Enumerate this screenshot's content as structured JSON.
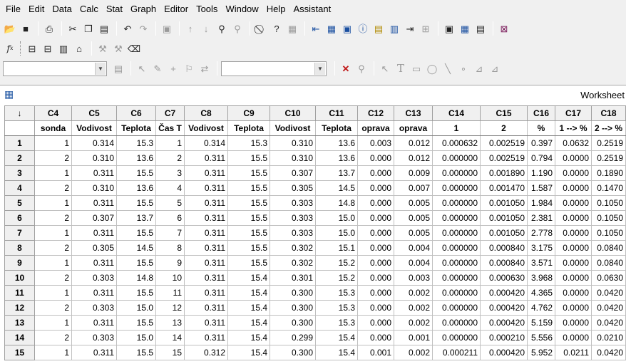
{
  "menu": [
    "File",
    "Edit",
    "Data",
    "Calc",
    "Stat",
    "Graph",
    "Editor",
    "Tools",
    "Window",
    "Help",
    "Assistant"
  ],
  "toolbar_icons": {
    "row1": [
      "open-icon",
      "save-icon",
      "|",
      "print-icon",
      "|",
      "cut-icon",
      "copy-icon",
      "paste-icon",
      "|",
      "undo-icon",
      "redo-icon",
      "|",
      "edit-last-dialog-icon",
      "|",
      "up-arrow-icon",
      "down-arrow-icon",
      "find-icon",
      "find-next-icon",
      "|",
      "cancel-icon",
      "help-icon",
      "assistant-icon",
      "|",
      "session-window-icon",
      "worksheet-icon",
      "project-manager-icon",
      "info-icon",
      "history-icon",
      "graphs-icon",
      "reports-icon",
      "related-documents-icon",
      "|",
      "tile-icon",
      "show-worksheet-icon",
      "show-info-icon",
      "|",
      "close-all-graphs-icon"
    ],
    "row2": [
      "formula-icon",
      "|",
      "brush-icon",
      "select-data-icon",
      "graph-data-icon",
      "update-icon",
      "|",
      "brush-disabled-icon",
      "brush2-disabled-icon",
      "eraser-icon"
    ],
    "row3": [
      "select-icon",
      "edit-icon",
      "crosshair-icon",
      "flag-icon",
      "swap-icon",
      "|",
      "delete-icon",
      "zoom-icon",
      "|",
      "pointer-icon",
      "text-icon",
      "rectangle-icon",
      "ellipse-icon",
      "line-icon",
      "dot-icon",
      "polyline-icon",
      "polygon-icon"
    ]
  },
  "combos": {
    "combo1": "",
    "combo2": ""
  },
  "worksheet": {
    "title": "Worksheet",
    "corner_symbol": "↓",
    "columns": [
      "C4",
      "C5",
      "C6",
      "C7",
      "C8",
      "C9",
      "C10",
      "C11",
      "C12",
      "C13",
      "C14",
      "C15",
      "C16",
      "C17",
      "C18"
    ],
    "column_names": [
      "sonda",
      "Vodivost",
      "Teplota",
      "Čas T",
      "Vodivost",
      "Teplota",
      "Vodivost",
      "Teplota",
      "oprava",
      "oprava",
      "1",
      "2",
      "%",
      "1 --> %",
      "2 --> %"
    ],
    "rows": [
      {
        "n": "1",
        "v": [
          "1",
          "0.314",
          "15.3",
          "1",
          "0.314",
          "15.3",
          "0.310",
          "13.6",
          "0.003",
          "0.012",
          "0.000632",
          "0.002519",
          "0.397",
          "0.0632",
          "0.2519"
        ]
      },
      {
        "n": "2",
        "v": [
          "2",
          "0.310",
          "13.6",
          "2",
          "0.311",
          "15.5",
          "0.310",
          "13.6",
          "0.000",
          "0.012",
          "0.000000",
          "0.002519",
          "0.794",
          "0.0000",
          "0.2519"
        ]
      },
      {
        "n": "3",
        "v": [
          "1",
          "0.311",
          "15.5",
          "3",
          "0.311",
          "15.5",
          "0.307",
          "13.7",
          "0.000",
          "0.009",
          "0.000000",
          "0.001890",
          "1.190",
          "0.0000",
          "0.1890"
        ]
      },
      {
        "n": "4",
        "v": [
          "2",
          "0.310",
          "13.6",
          "4",
          "0.311",
          "15.5",
          "0.305",
          "14.5",
          "0.000",
          "0.007",
          "0.000000",
          "0.001470",
          "1.587",
          "0.0000",
          "0.1470"
        ]
      },
      {
        "n": "5",
        "v": [
          "1",
          "0.311",
          "15.5",
          "5",
          "0.311",
          "15.5",
          "0.303",
          "14.8",
          "0.000",
          "0.005",
          "0.000000",
          "0.001050",
          "1.984",
          "0.0000",
          "0.1050"
        ]
      },
      {
        "n": "6",
        "v": [
          "2",
          "0.307",
          "13.7",
          "6",
          "0.311",
          "15.5",
          "0.303",
          "15.0",
          "0.000",
          "0.005",
          "0.000000",
          "0.001050",
          "2.381",
          "0.0000",
          "0.1050"
        ]
      },
      {
        "n": "7",
        "v": [
          "1",
          "0.311",
          "15.5",
          "7",
          "0.311",
          "15.5",
          "0.303",
          "15.0",
          "0.000",
          "0.005",
          "0.000000",
          "0.001050",
          "2.778",
          "0.0000",
          "0.1050"
        ]
      },
      {
        "n": "8",
        "v": [
          "2",
          "0.305",
          "14.5",
          "8",
          "0.311",
          "15.5",
          "0.302",
          "15.1",
          "0.000",
          "0.004",
          "0.000000",
          "0.000840",
          "3.175",
          "0.0000",
          "0.0840"
        ]
      },
      {
        "n": "9",
        "v": [
          "1",
          "0.311",
          "15.5",
          "9",
          "0.311",
          "15.5",
          "0.302",
          "15.2",
          "0.000",
          "0.004",
          "0.000000",
          "0.000840",
          "3.571",
          "0.0000",
          "0.0840"
        ]
      },
      {
        "n": "10",
        "v": [
          "2",
          "0.303",
          "14.8",
          "10",
          "0.311",
          "15.4",
          "0.301",
          "15.2",
          "0.000",
          "0.003",
          "0.000000",
          "0.000630",
          "3.968",
          "0.0000",
          "0.0630"
        ]
      },
      {
        "n": "11",
        "v": [
          "1",
          "0.311",
          "15.5",
          "11",
          "0.311",
          "15.4",
          "0.300",
          "15.3",
          "0.000",
          "0.002",
          "0.000000",
          "0.000420",
          "4.365",
          "0.0000",
          "0.0420"
        ]
      },
      {
        "n": "12",
        "v": [
          "2",
          "0.303",
          "15.0",
          "12",
          "0.311",
          "15.4",
          "0.300",
          "15.3",
          "0.000",
          "0.002",
          "0.000000",
          "0.000420",
          "4.762",
          "0.0000",
          "0.0420"
        ]
      },
      {
        "n": "13",
        "v": [
          "1",
          "0.311",
          "15.5",
          "13",
          "0.311",
          "15.4",
          "0.300",
          "15.3",
          "0.000",
          "0.002",
          "0.000000",
          "0.000420",
          "5.159",
          "0.0000",
          "0.0420"
        ]
      },
      {
        "n": "14",
        "v": [
          "2",
          "0.303",
          "15.0",
          "14",
          "0.311",
          "15.4",
          "0.299",
          "15.4",
          "0.000",
          "0.001",
          "0.000000",
          "0.000210",
          "5.556",
          "0.0000",
          "0.0210"
        ]
      },
      {
        "n": "15",
        "v": [
          "1",
          "0.311",
          "15.5",
          "15",
          "0.312",
          "15.4",
          "0.300",
          "15.4",
          "0.001",
          "0.002",
          "0.000211",
          "0.000420",
          "5.952",
          "0.0211",
          "0.0420"
        ]
      }
    ]
  }
}
